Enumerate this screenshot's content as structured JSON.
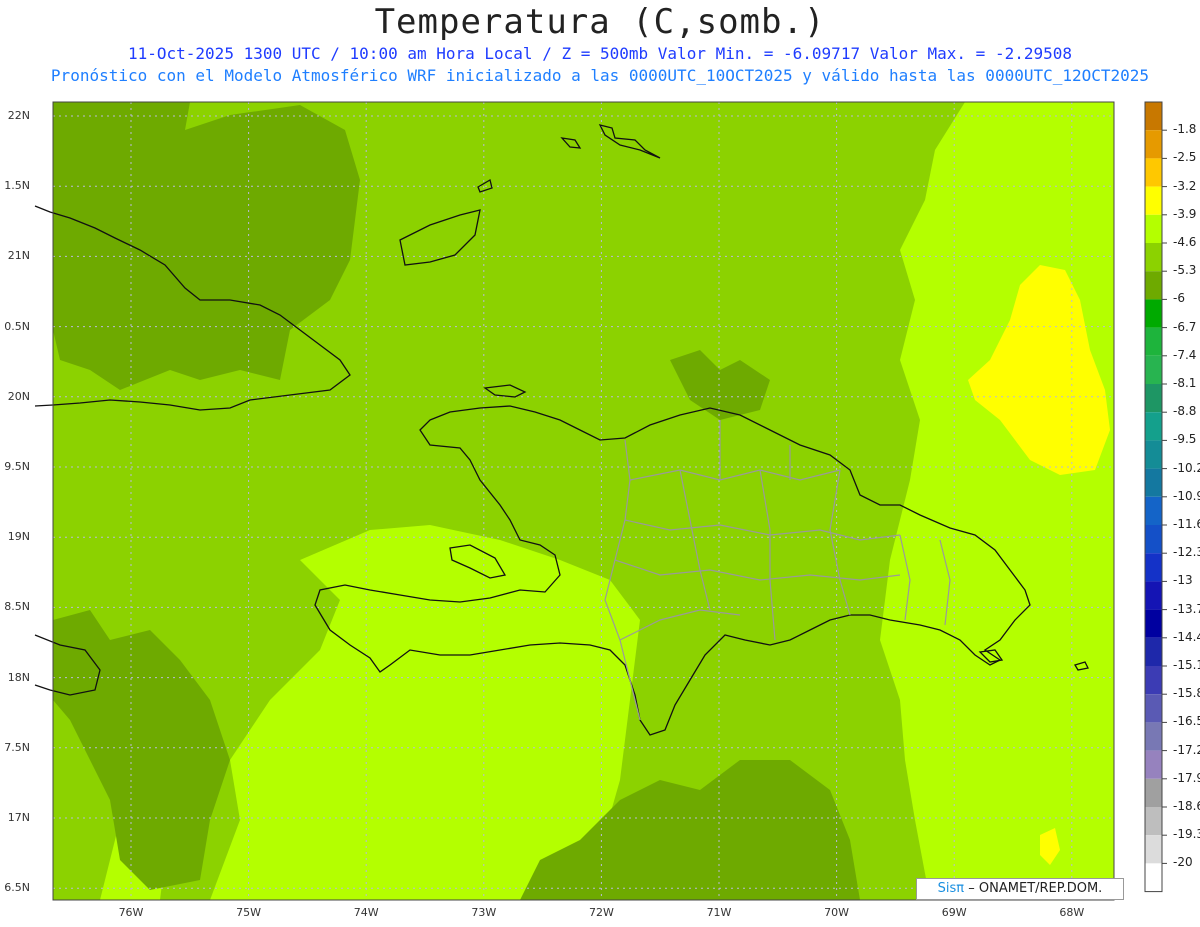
{
  "title": "Temperatura (C,somb.)",
  "subtitle_line1": "11-Oct-2025  1300 UTC / 10:00 am Hora Local / Z = 500mb  Valor Min. = -6.09717  Valor Max. = -2.29508",
  "subtitle_line2": "Pronóstico con el Modelo Atmosférico WRF inicializado a las 0000UTC_10OCT2025 y válido hasta las  0000UTC_12OCT2025",
  "lat_labels": [
    "22N",
    "1.5N",
    "21N",
    "0.5N",
    "20N",
    "9.5N",
    "19N",
    "8.5N",
    "18N",
    "7.5N",
    "17N",
    "6.5N"
  ],
  "lon_labels": [
    "76W",
    "75W",
    "74W",
    "73W",
    "72W",
    "71W",
    "70W",
    "69W",
    "68W"
  ],
  "colorbar": {
    "labels": [
      "-1.8",
      "-2.5",
      "-3.2",
      "-3.9",
      "-4.6",
      "-5.3",
      "-6",
      "-6.7",
      "-7.4",
      "-8.1",
      "-8.8",
      "-9.5",
      "-10.2",
      "-10.9",
      "-11.6",
      "-12.3",
      "-13",
      "-13.7",
      "-14.4",
      "-15.1",
      "-15.8",
      "-16.5",
      "-17.2",
      "-17.9",
      "-18.6",
      "-19.3",
      "-20"
    ],
    "colors": [
      "#c87800",
      "#e69a00",
      "#ffc800",
      "#ffff00",
      "#b4ff00",
      "#8cd200",
      "#6eaa00",
      "#00aa00",
      "#1eb43c",
      "#28b450",
      "#1e9664",
      "#14a08c",
      "#148c96",
      "#1478a0",
      "#1464c8",
      "#1450c8",
      "#1432c8",
      "#1414b4",
      "#0000a0",
      "#1e28aa",
      "#3c3cb4",
      "#5a5ab4",
      "#7878b4",
      "#9682be",
      "#a0a0a0",
      "#bebebe",
      "#dcdcdc",
      "#ffffff"
    ]
  },
  "field_colors": {
    "light": "#b4ff00",
    "mid": "#8cd200",
    "dark": "#6eaa00",
    "warm": "#ffff00"
  },
  "credit": {
    "logo": "Sisπ",
    "text": "– ONAMET/REP.DOM."
  }
}
